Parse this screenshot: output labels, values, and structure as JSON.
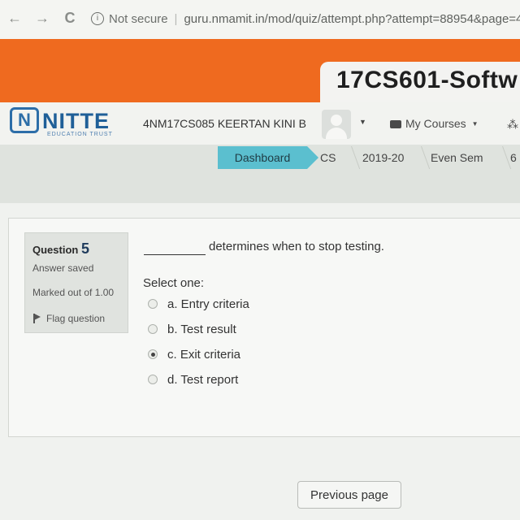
{
  "browser": {
    "back_glyph": "←",
    "forward_glyph": "→",
    "reload_glyph": "C",
    "security_text": "Not secure",
    "url": "guru.nmamit.in/mod/quiz/attempt.php?attempt=88954&page=4"
  },
  "course": {
    "title": "17CS601-Softw"
  },
  "header": {
    "logo_text": "NITTE",
    "logo_subtext": "EDUCATION TRUST",
    "user_name": "4NM17CS085 KEERTAN KINI B",
    "my_courses_label": "My Courses",
    "caret_glyph": "▼"
  },
  "breadcrumb": [
    "Dashboard",
    "CS",
    "2019-20",
    "Even Sem",
    "6"
  ],
  "question": {
    "label": "Question",
    "number": "5",
    "state": "Answer saved",
    "grade": "Marked out of 1.00",
    "flag_label": "Flag question",
    "text": "determines when to stop testing.",
    "prompt": "Select one:",
    "options": [
      {
        "label": "a. Entry criteria",
        "checked": false
      },
      {
        "label": "b. Test result",
        "checked": false
      },
      {
        "label": "c. Exit criteria",
        "checked": true
      },
      {
        "label": "d. Test report",
        "checked": false
      }
    ]
  },
  "navigation": {
    "previous_label": "Previous page"
  },
  "colors": {
    "banner": "#ef6a1f",
    "breadcrumb_active": "#5bbfcf",
    "brand_blue": "#1f5f98"
  }
}
